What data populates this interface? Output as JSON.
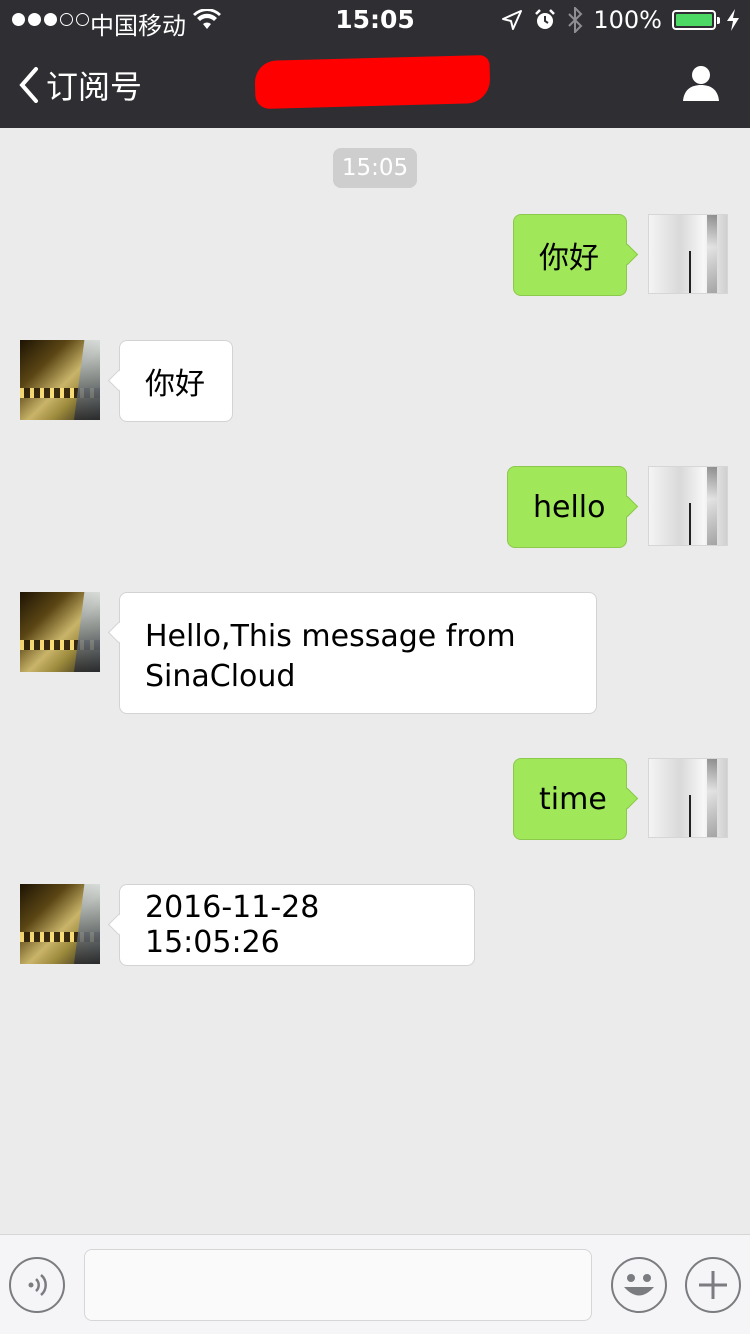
{
  "status_bar": {
    "carrier": "中国移动",
    "time": "15:05",
    "battery_text": "100%",
    "battery_level": 1.0,
    "signal_bars_filled": 3,
    "signal_bars_total": 5
  },
  "nav": {
    "back_label": "订阅号",
    "title": ""
  },
  "chat": {
    "timestamp": "15:05",
    "messages": [
      {
        "sender": "me",
        "text": "你好"
      },
      {
        "sender": "bot",
        "text": "你好"
      },
      {
        "sender": "me",
        "text": "hello"
      },
      {
        "sender": "bot",
        "text": "Hello,This message from SinaCloud"
      },
      {
        "sender": "me",
        "text": "time"
      },
      {
        "sender": "bot",
        "text": "2016-11-28 15:05:26"
      }
    ]
  },
  "input_bar": {
    "message_value": ""
  },
  "colors": {
    "nav_background": "#2e2e33",
    "chat_background": "#ebebeb",
    "my_bubble": "#a0e75a",
    "bot_bubble": "#ffffff",
    "battery_fill": "#4cd964",
    "redaction": "#ff0000"
  },
  "icons": [
    "signal-dots-icon",
    "wifi-icon",
    "location-arrow-icon",
    "alarm-icon",
    "bluetooth-icon",
    "battery-icon",
    "charging-bolt-icon",
    "back-chevron-icon",
    "person-icon",
    "voice-icon",
    "emoji-icon",
    "plus-icon"
  ]
}
